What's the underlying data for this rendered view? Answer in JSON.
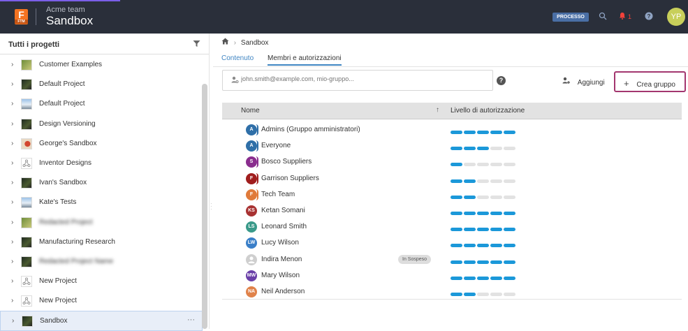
{
  "header": {
    "logo_letter": "F",
    "logo_sub": "FTM",
    "team": "Acme team",
    "project": "Sandbox",
    "process_badge": "PROCESSO",
    "notif_count": "1",
    "avatar_initials": "YP",
    "avatar_color": "#c8cf5a"
  },
  "sidebar": {
    "title": "Tutti i progetti",
    "items": [
      {
        "label": "Customer Examples",
        "thumb": "landscape",
        "blurred": false
      },
      {
        "label": "Default Project",
        "thumb": "dark",
        "blurred": false
      },
      {
        "label": "Default Project",
        "thumb": "sky",
        "blurred": false
      },
      {
        "label": "Design Versioning",
        "thumb": "dark",
        "blurred": false
      },
      {
        "label": "George's Sandbox",
        "thumb": "red",
        "blurred": false
      },
      {
        "label": "Inventor Designs",
        "thumb": "placeholder",
        "blurred": false
      },
      {
        "label": "Ivan's Sandbox",
        "thumb": "dark",
        "blurred": false
      },
      {
        "label": "Kate's Tests",
        "thumb": "sky",
        "blurred": false
      },
      {
        "label": "Redacted Project",
        "thumb": "landscape",
        "blurred": true
      },
      {
        "label": "Manufacturing Research",
        "thumb": "dark",
        "blurred": false
      },
      {
        "label": "Redacted Project Name",
        "thumb": "dark",
        "blurred": true
      },
      {
        "label": "New Project",
        "thumb": "placeholder",
        "blurred": false
      },
      {
        "label": "New Project",
        "thumb": "placeholder",
        "blurred": false
      },
      {
        "label": "Sandbox",
        "thumb": "dark",
        "blurred": false,
        "selected": true
      }
    ]
  },
  "main": {
    "breadcrumb": "Sandbox",
    "tabs": [
      {
        "label": "Contenuto",
        "active": false
      },
      {
        "label": "Membri e autorizzazioni",
        "active": true
      }
    ],
    "search_placeholder": "john.smith@example.com, mio-gruppo...",
    "add_label": "Aggiungi",
    "create_group_label": "Crea gruppo",
    "columns": {
      "name": "Nome",
      "level": "Livello di autorizzazione"
    },
    "members": [
      {
        "name": "Admins (Gruppo amministratori)",
        "initials": "A",
        "color": "#2f6fa8",
        "group": true,
        "level": 5
      },
      {
        "name": "Everyone",
        "initials": "A",
        "color": "#2f6fa8",
        "group": true,
        "level": 3
      },
      {
        "name": "Bosco Suppliers",
        "initials": "S",
        "color": "#8a2d8e",
        "group": true,
        "level": 1
      },
      {
        "name": "Garrison Suppliers",
        "initials": "F",
        "color": "#a01d1d",
        "group": true,
        "level": 2
      },
      {
        "name": "Tech Team",
        "initials": "F",
        "color": "#e07a3a",
        "group": true,
        "level": 2
      },
      {
        "name": "Ketan Somani",
        "initials": "KS",
        "color": "#a83232",
        "group": false,
        "level": 5
      },
      {
        "name": "Leonard Smith",
        "initials": "LS",
        "color": "#3a9a8a",
        "group": false,
        "level": 5
      },
      {
        "name": "Lucy Wilson",
        "initials": "LW",
        "color": "#3a7fc8",
        "group": false,
        "level": 5
      },
      {
        "name": "Indira Menon",
        "initials": "",
        "color": "#cfcfcf",
        "group": false,
        "level": 5,
        "pending": "In Sospeso"
      },
      {
        "name": "Mary Wilson",
        "initials": "MW",
        "color": "#6a3fa8",
        "group": false,
        "level": 5
      },
      {
        "name": "Neil Anderson",
        "initials": "NA",
        "color": "#e0824a",
        "group": false,
        "level": 2
      }
    ]
  }
}
